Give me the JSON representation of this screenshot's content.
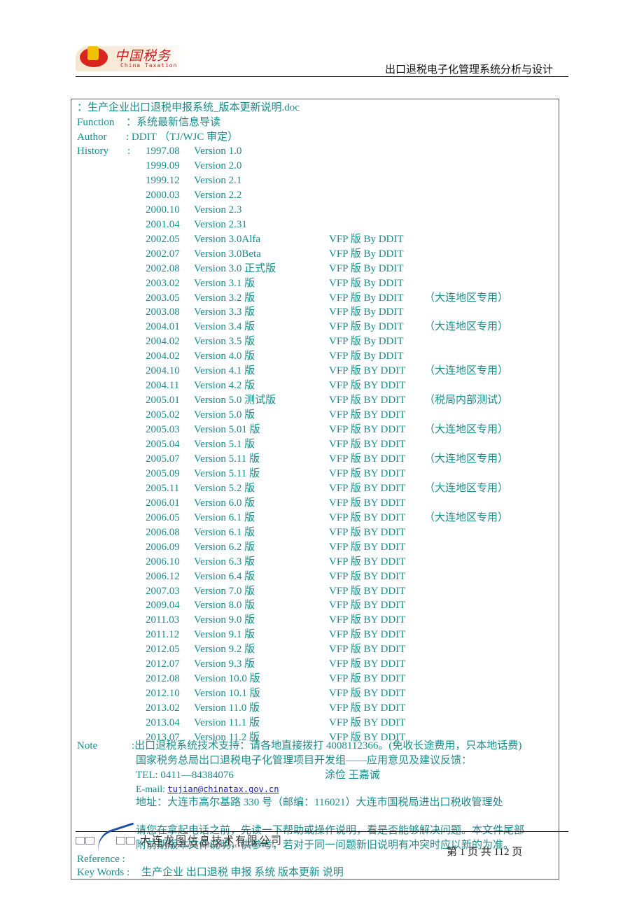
{
  "header": {
    "logo_cn": "中国税务",
    "logo_en": "China Taxation",
    "title": "出口退税电子化管理系统分析与设计"
  },
  "doc": {
    "filename_line": "：生产企业出口退税申报系统_版本更新说明.doc",
    "function_label": "Function",
    "function_value": "：系统最新信息导读",
    "author_label": "Author",
    "author_value": ":    DDIT （TJ/WJC 审定）",
    "history_label": "History",
    "history_colon": ":",
    "history": [
      {
        "date": "1997.08",
        "version": "Version 1.0",
        "by": "",
        "remark": ""
      },
      {
        "date": "1999.09",
        "version": "Version 2.0",
        "by": "",
        "remark": ""
      },
      {
        "date": "1999.12",
        "version": "Version 2.1",
        "by": "",
        "remark": ""
      },
      {
        "date": "2000.03",
        "version": "Version 2.2",
        "by": "",
        "remark": ""
      },
      {
        "date": "2000.10",
        "version": "Version 2.3",
        "by": "",
        "remark": ""
      },
      {
        "date": "2001.04",
        "version": "Version 2.31",
        "by": "",
        "remark": ""
      },
      {
        "date": "2002.05",
        "version": "Version 3.0Alfa",
        "by": "VFP  版  By DDIT",
        "remark": ""
      },
      {
        "date": "2002.07",
        "version": "Version 3.0Beta",
        "by": "VFP  版  By DDIT",
        "remark": ""
      },
      {
        "date": "2002.08",
        "version": "Version 3.0 正式版",
        "by": "VFP  版  By DDIT",
        "remark": ""
      },
      {
        "date": "2003.02",
        "version": "Version 3.1 版",
        "by": "VFP  版  By DDIT",
        "remark": ""
      },
      {
        "date": "2003.05",
        "version": "Version 3.2 版",
        "by": "VFP  版 By DDIT",
        "remark": "（大连地区专用）"
      },
      {
        "date": "2003.08",
        "version": "Version 3.3 版",
        "by": "VFP  版 By DDIT",
        "remark": ""
      },
      {
        "date": "2004.01",
        "version": "Version 3.4 版",
        "by": "VFP  版 By DDIT",
        "remark": "（大连地区专用）"
      },
      {
        "date": "2004.02",
        "version": "Version 3.5 版",
        "by": "VFP  版 By DDIT",
        "remark": ""
      },
      {
        "date": "2004.02",
        "version": "Version 4.0 版",
        "by": "VFP  版 By DDIT",
        "remark": ""
      },
      {
        "date": "2004.10",
        "version": "Version 4.1 版",
        "by": "VFP  版 BY DDIT",
        "remark": "（大连地区专用）"
      },
      {
        "date": "2004.11",
        "version": "Version 4.2 版",
        "by": "VFP  版 BY DDIT",
        "remark": ""
      },
      {
        "date": "2005.01",
        "version": "Version 5.0 测试版",
        "by": "VFP  版 BY DDIT",
        "remark": "（税局内部测试）"
      },
      {
        "date": "2005.02",
        "version": "Version 5.0 版",
        "by": "VFP  版 BY DDIT",
        "remark": ""
      },
      {
        "date": "2005.03",
        "version": "Version 5.01 版",
        "by": "VFP  版 BY DDIT",
        "remark": "（大连地区专用）"
      },
      {
        "date": "2005.04",
        "version": "Version 5.1 版",
        "by": "VFP  版 BY DDIT",
        "remark": ""
      },
      {
        "date": "2005.07",
        "version": "Version 5.11 版",
        "by": "VFP  版 BY DDIT",
        "remark": "（大连地区专用）"
      },
      {
        "date": "2005.09",
        "version": "Version 5.11 版",
        "by": "VFP  版 BY DDIT",
        "remark": ""
      },
      {
        "date": "2005.11",
        "version": "Version 5.2 版",
        "by": "VFP  版 BY DDIT",
        "remark": "（大连地区专用）"
      },
      {
        "date": "2006.01",
        "version": "Version 6.0 版",
        "by": "VFP  版 BY DDIT",
        "remark": ""
      },
      {
        "date": "2006.05",
        "version": "Version 6.1 版",
        "by": "VFP  版 BY DDIT",
        "remark": "（大连地区专用）"
      },
      {
        "date": "2006.08",
        "version": "Version 6.1 版",
        "by": "VFP  版 BY DDIT",
        "remark": ""
      },
      {
        "date": "2006.09",
        "version": "Version 6.2 版",
        "by": "VFP  版 BY DDIT",
        "remark": ""
      },
      {
        "date": "2006.10",
        "version": "Version 6.3 版",
        "by": "VFP  版 BY DDIT",
        "remark": ""
      },
      {
        "date": "2006.12",
        "version": "Version 6.4 版",
        "by": "VFP  版 BY DDIT",
        "remark": ""
      },
      {
        "date": "2007.03",
        "version": "Version 7.0 版",
        "by": "VFP  版 BY DDIT",
        "remark": ""
      },
      {
        "date": "2009.04",
        "version": "Version 8.0 版",
        "by": "VFP  版 BY DDIT",
        "remark": ""
      },
      {
        "date": "2011.03",
        "version": "Version 9.0 版",
        "by": "VFP  版 BY DDIT",
        "remark": ""
      },
      {
        "date": "2011.12",
        "version": "Version 9.1 版",
        "by": "VFP  版 BY DDIT",
        "remark": ""
      },
      {
        "date": "2012.05",
        "version": "Version 9.2 版",
        "by": "VFP  版 BY DDIT",
        "remark": ""
      },
      {
        "date": "2012.07",
        "version": "Version 9.3 版",
        "by": "VFP  版 BY DDIT",
        "remark": ""
      },
      {
        "date": "2012.08",
        "version": "Version 10.0 版",
        "by": "VFP  版 BY DDIT",
        "remark": ""
      },
      {
        "date": "2012.10",
        "version": "Version 10.1 版",
        "by": "VFP  版 BY DDIT",
        "remark": ""
      },
      {
        "date": "2013.02",
        "version": "Version 11.0 版",
        "by": "VFP  版 BY DDIT",
        "remark": ""
      },
      {
        "date": "2013.04",
        "version": "Version 11.1 版",
        "by": "VFP  版 BY DDIT",
        "remark": ""
      },
      {
        "date": "2013.07",
        "version": "Version 11.2 版",
        "by": "VFP  版 BY DDIT",
        "remark": ""
      }
    ],
    "note_label": "Note",
    "note_lines": {
      "support": ":出口退税系统技术支持：请各地直接拨打 4008112366。(免收长途费用，只本地话费)",
      "feedback": "国家税务总局出口退税电子化管理项目开发组——应用意见及建议反馈：",
      "tel": "TEL:    0411—84384076",
      "contacts": "涂俭    王嘉诚",
      "email_label": "E-mail: ",
      "email": "tujian@chinatax.gov.cn",
      "address": "地址：大连市高尔基路 330 号（邮编：116021）大连市国税局进出口税收管理处",
      "advice1": "请您在拿起电话之前，先读一下帮助或操作说明，看是否能够解决问题。本文件尾部",
      "advice2": "附前期版本文件说明，供参考，若对于同一问题新旧说明有冲突时应以新的为准。"
    },
    "reference_label": "Reference :",
    "keywords_label": "Key Words :",
    "keywords_value": "生产企业  出口退税  申报  系统  版本更新  说明"
  },
  "footer": {
    "logo_text": "DRAGON",
    "company_cn": "大连龙图信息技术有限公司",
    "company_en": "DALIAN DRAGON DREAM INFORMATION TECHNOLOGY CO.,LTD.",
    "page_info": "第 1 页  共  112 页"
  },
  "colors": {
    "text_teal": "#1a8c8c",
    "link_blue": "#2323c8",
    "brand_red": "#c81e1e"
  }
}
